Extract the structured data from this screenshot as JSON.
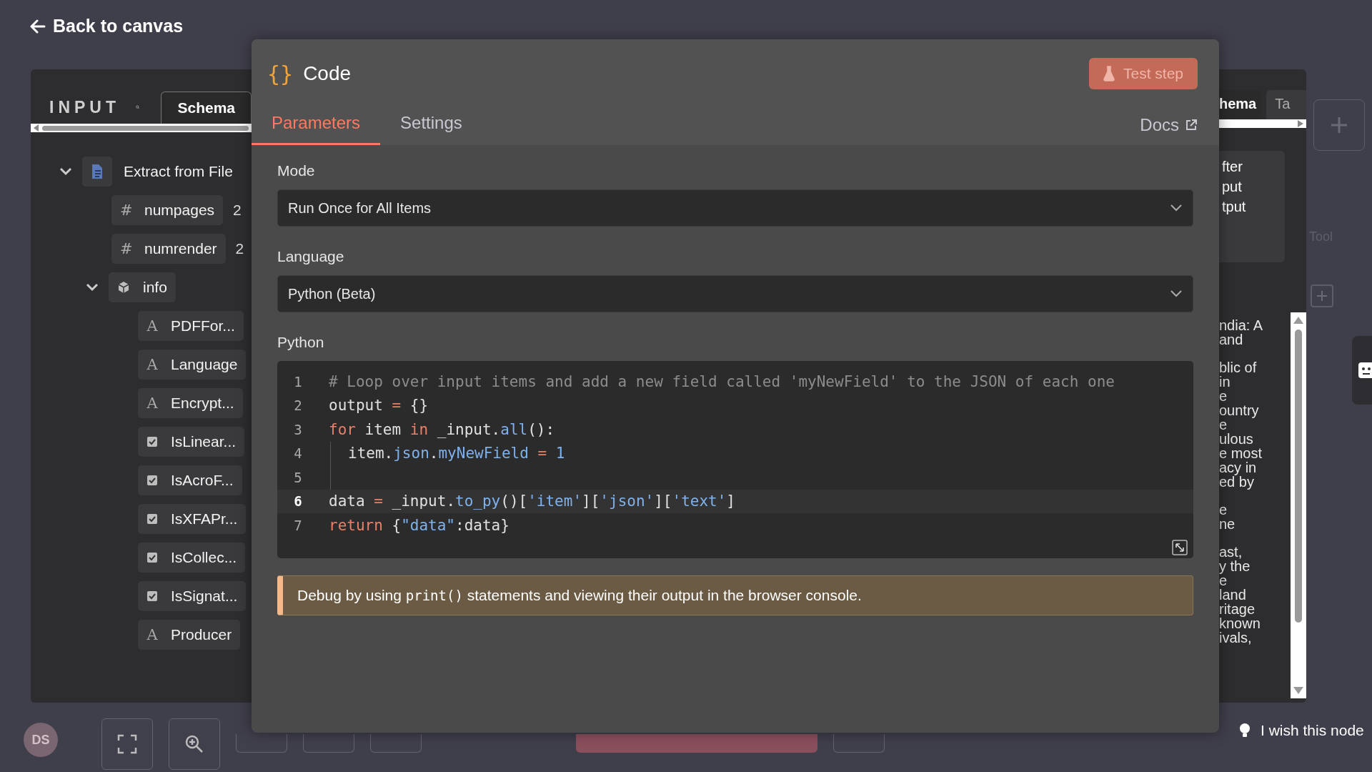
{
  "back_link": {
    "label": "Back to canvas"
  },
  "input_panel": {
    "title": "INPUT",
    "tab": "Schema",
    "tree": [
      {
        "kind": "node",
        "label": "Extract from File",
        "expanded": true,
        "children": [
          {
            "kind": "number",
            "glyph": "#",
            "label": "numpages",
            "value": "2"
          },
          {
            "kind": "number",
            "glyph": "#",
            "label": "numrender",
            "value": "2"
          },
          {
            "kind": "object",
            "label": "info",
            "expanded": true,
            "children": [
              {
                "kind": "string",
                "glyph": "A",
                "label": "PDFFor..."
              },
              {
                "kind": "string",
                "glyph": "A",
                "label": "Language"
              },
              {
                "kind": "string",
                "glyph": "A",
                "label": "Encrypt..."
              },
              {
                "kind": "boolean",
                "label": "IsLinear..."
              },
              {
                "kind": "boolean",
                "label": "IsAcroF..."
              },
              {
                "kind": "boolean",
                "label": "IsXFAPr..."
              },
              {
                "kind": "boolean",
                "label": "IsCollec..."
              },
              {
                "kind": "boolean",
                "label": "IsSignat..."
              },
              {
                "kind": "string",
                "glyph": "A",
                "label": "Producer"
              }
            ]
          }
        ]
      }
    ]
  },
  "modal": {
    "icon": "{}",
    "title": "Code",
    "test_button": {
      "label": "Test step",
      "disabled": true
    },
    "tabs": [
      {
        "label": "Parameters",
        "selected": true
      },
      {
        "label": "Settings",
        "selected": false
      }
    ],
    "docs_link": "Docs",
    "fields": [
      {
        "label": "Mode",
        "value": "Run Once for All Items"
      },
      {
        "label": "Language",
        "value": "Python (Beta)"
      }
    ],
    "editor": {
      "label": "Python",
      "lines": [
        {
          "number": "1",
          "selected": false,
          "indented": false,
          "tokens": [
            {
              "kind": "comment",
              "text": "# Loop over input items and add a new field called 'myNewField' to the JSON of each one"
            }
          ]
        },
        {
          "number": "2",
          "selected": false,
          "indented": false,
          "tokens": [
            {
              "kind": "plain",
              "text": "output "
            },
            {
              "kind": "operator",
              "text": "="
            },
            {
              "kind": "plain",
              "text": " {}"
            }
          ]
        },
        {
          "number": "3",
          "selected": false,
          "indented": false,
          "tokens": [
            {
              "kind": "keyword",
              "text": "for"
            },
            {
              "kind": "plain",
              "text": " item "
            },
            {
              "kind": "keyword",
              "text": "in"
            },
            {
              "kind": "plain",
              "text": " _input."
            },
            {
              "kind": "name",
              "text": "all"
            },
            {
              "kind": "plain",
              "text": "():"
            }
          ]
        },
        {
          "number": "4",
          "selected": false,
          "indented": true,
          "tokens": [
            {
              "kind": "plain",
              "text": "item."
            },
            {
              "kind": "name",
              "text": "json"
            },
            {
              "kind": "plain",
              "text": "."
            },
            {
              "kind": "name",
              "text": "myNewField"
            },
            {
              "kind": "operator",
              "text": " = "
            },
            {
              "kind": "number",
              "text": "1"
            }
          ]
        },
        {
          "number": "5",
          "selected": false,
          "indented": true
        },
        {
          "number": "6",
          "selected": true,
          "indented": false,
          "tokens": [
            {
              "kind": "plain",
              "text": "data "
            },
            {
              "kind": "operator",
              "text": "="
            },
            {
              "kind": "plain",
              "text": " _input."
            },
            {
              "kind": "name",
              "text": "to_py"
            },
            {
              "kind": "plain",
              "text": "()["
            },
            {
              "kind": "string",
              "text": "'item'"
            },
            {
              "kind": "plain",
              "text": "]["
            },
            {
              "kind": "string",
              "text": "'json'"
            },
            {
              "kind": "plain",
              "text": "]["
            },
            {
              "kind": "string",
              "text": "'text'"
            },
            {
              "kind": "plain",
              "text": "]"
            }
          ]
        },
        {
          "number": "7",
          "selected": false,
          "indented": false,
          "tokens": [
            {
              "kind": "keyword",
              "text": "return"
            },
            {
              "kind": "plain",
              "text": " {"
            },
            {
              "kind": "string",
              "text": "\"data\""
            },
            {
              "kind": "plain",
              "text": ":data}"
            }
          ]
        }
      ]
    },
    "notice": {
      "before": "Debug by using",
      "code": "print()",
      "after": "statements and viewing their output in the browser console."
    }
  },
  "output_panel": {
    "tabs": [
      {
        "label": "hema",
        "selected": true
      },
      {
        "label": "Ta",
        "selected": false
      }
    ],
    "box_lines": [
      "fter",
      "put",
      "tput"
    ],
    "paragraphs": [
      [
        "ndia: A",
        "and"
      ],
      [
        "blic of",
        "in",
        "e",
        "ountry",
        "e",
        "ulous",
        "e most",
        "acy in",
        "ed by"
      ],
      [
        "e",
        "ne"
      ],
      [
        "ast,",
        "y the",
        "e",
        "land",
        "ritage",
        "known",
        "ivals,"
      ]
    ]
  },
  "canvas": {
    "tool_label": "Tool",
    "hint": "I wish this node"
  },
  "toolbar": {
    "avatar": "DS"
  }
}
